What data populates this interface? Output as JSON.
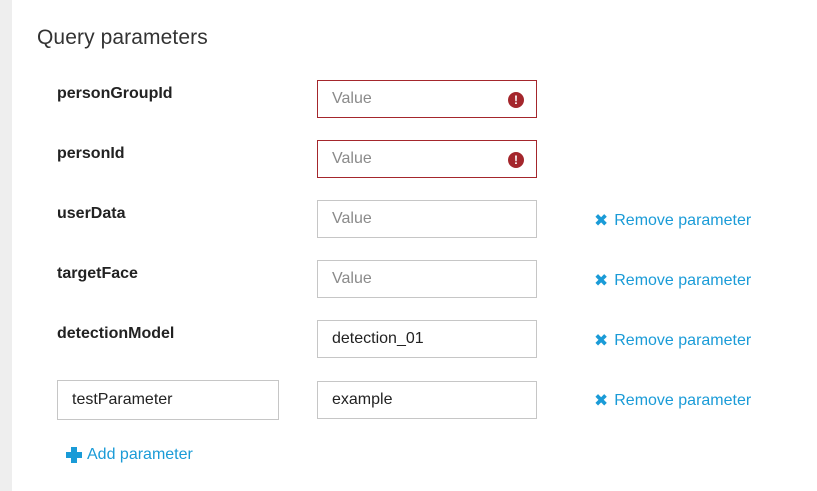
{
  "section": {
    "title": "Query parameters"
  },
  "params": [
    {
      "name": "personGroupId",
      "value": "",
      "placeholder": "Value",
      "error": true
    },
    {
      "name": "personId",
      "value": "",
      "placeholder": "Value",
      "error": true
    },
    {
      "name": "userData",
      "value": "",
      "placeholder": "Value",
      "remove_label": "Remove parameter"
    },
    {
      "name": "targetFace",
      "value": "",
      "placeholder": "Value",
      "remove_label": "Remove parameter"
    },
    {
      "name": "detectionModel",
      "value": "detection_01",
      "placeholder": "Value",
      "remove_label": "Remove parameter"
    }
  ],
  "custom_param": {
    "name": "testParameter",
    "value": "example",
    "remove_label": "Remove parameter"
  },
  "add_label": "Add parameter",
  "icons": {
    "error": "exclamation-circle-icon",
    "remove": "x-icon",
    "add": "plus-icon"
  },
  "colors": {
    "link": "#1a9bd7",
    "error": "#a4262c"
  }
}
